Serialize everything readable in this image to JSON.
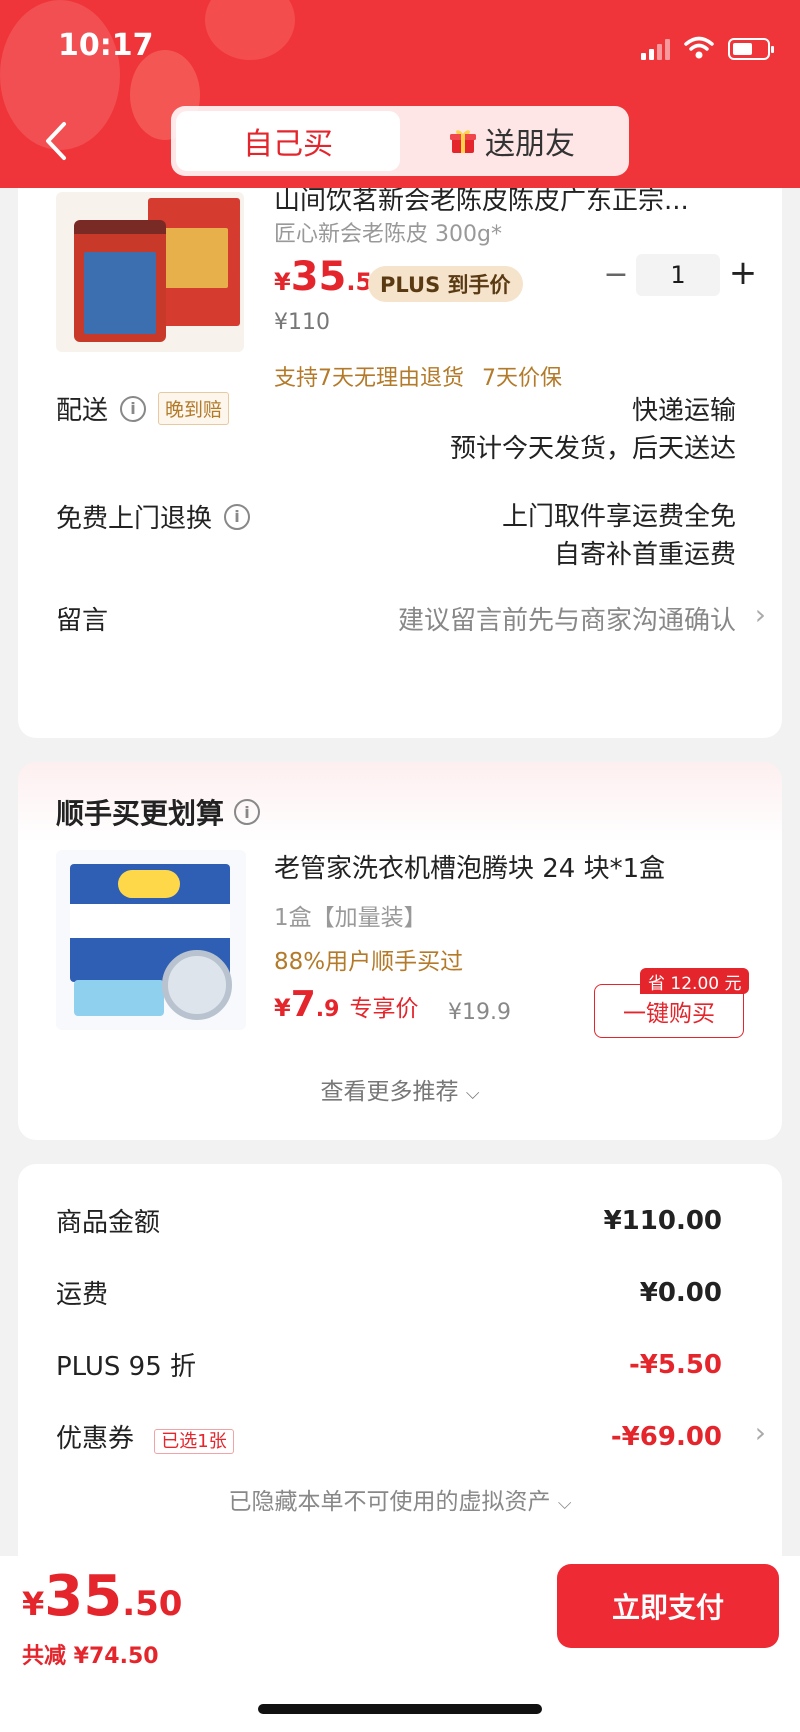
{
  "status_bar": {
    "time": "10:17"
  },
  "header": {
    "tabs": [
      {
        "label": "自己买",
        "active": true
      },
      {
        "label": "送朋友",
        "active": false
      }
    ],
    "accent_color": "#f0353a"
  },
  "product": {
    "title": "山间饮茗新会老陈皮陈皮广东正宗...",
    "spec": "匠心新会老陈皮 300g*",
    "price_currency": "¥",
    "price_int": "35",
    "price_dec": ".5",
    "price_tag": "PLUS 到手价",
    "original_price": "¥110",
    "quantity": "1",
    "minus_label": "−",
    "plus_label": "+",
    "services": [
      "支持7天无理由退货",
      "7天价保"
    ]
  },
  "delivery": {
    "label": "配送",
    "badge": "晚到赔",
    "method": "快递运输",
    "estimate": "预计今天发货，后天送达"
  },
  "returns": {
    "label": "免费上门退换",
    "line1": "上门取件享运费全免",
    "line2": "自寄补首重运费"
  },
  "message": {
    "label": "留言",
    "placeholder": "建议留言前先与商家沟通确认"
  },
  "addon": {
    "title": "顺手买更划算",
    "name": "老管家洗衣机槽泡腾块 24 块*1盒",
    "spec": "1盒【加量装】",
    "buyers": "88%用户顺手买过",
    "price_currency": "¥",
    "price_int": "7",
    "price_dec": ".9",
    "price_label": "专享价",
    "original_price": "¥19.9",
    "save_tag": "省 12.00 元",
    "buy_button": "一键购买",
    "more": "查看更多推荐"
  },
  "summary": {
    "rows": [
      {
        "label": "商品金额",
        "value": "¥110.00"
      },
      {
        "label": "运费",
        "value": "¥0.00"
      },
      {
        "label": "PLUS 95 折",
        "value": "-¥5.50"
      },
      {
        "label": "优惠券",
        "badge": "已选1张",
        "value": "-¥69.00"
      }
    ],
    "hidden_note": "已隐藏本单不可使用的虚拟资产"
  },
  "footer": {
    "total_currency": "¥",
    "total_int": "35",
    "total_dec": ".50",
    "saved": "共减 ¥74.50",
    "pay_button": "立即支付"
  }
}
